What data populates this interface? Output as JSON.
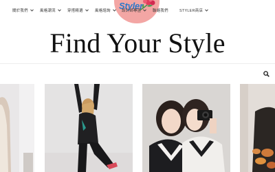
{
  "logo": {
    "text": "Styler"
  },
  "site": {
    "title": "Find Your Style"
  },
  "nav": {
    "items": [
      {
        "label": "關於我們",
        "has_dropdown": true
      },
      {
        "label": "風格潮流",
        "has_dropdown": true
      },
      {
        "label": "穿搭精選",
        "has_dropdown": true
      },
      {
        "label": "風格諮詢",
        "has_dropdown": true
      },
      {
        "label": "設計師專區",
        "has_dropdown": true
      },
      {
        "label": "聯絡我們",
        "has_dropdown": false
      },
      {
        "label": "STYLER商店",
        "has_dropdown": true
      }
    ],
    "search_icon": "search-icon"
  },
  "gallery": {
    "photos": [
      {
        "subject": "woman in white knit outfit (cropped)"
      },
      {
        "subject": "woman in black sportswear stretching"
      },
      {
        "subject": "two women in black and white v-neck sweaters with camera"
      },
      {
        "subject": "person with autumn leaves (cropped)"
      }
    ]
  },
  "colors": {
    "logo_bg": "#f3a6a4",
    "logo_text": "#2d78c8",
    "title": "#111111",
    "nav_text": "#333333"
  }
}
